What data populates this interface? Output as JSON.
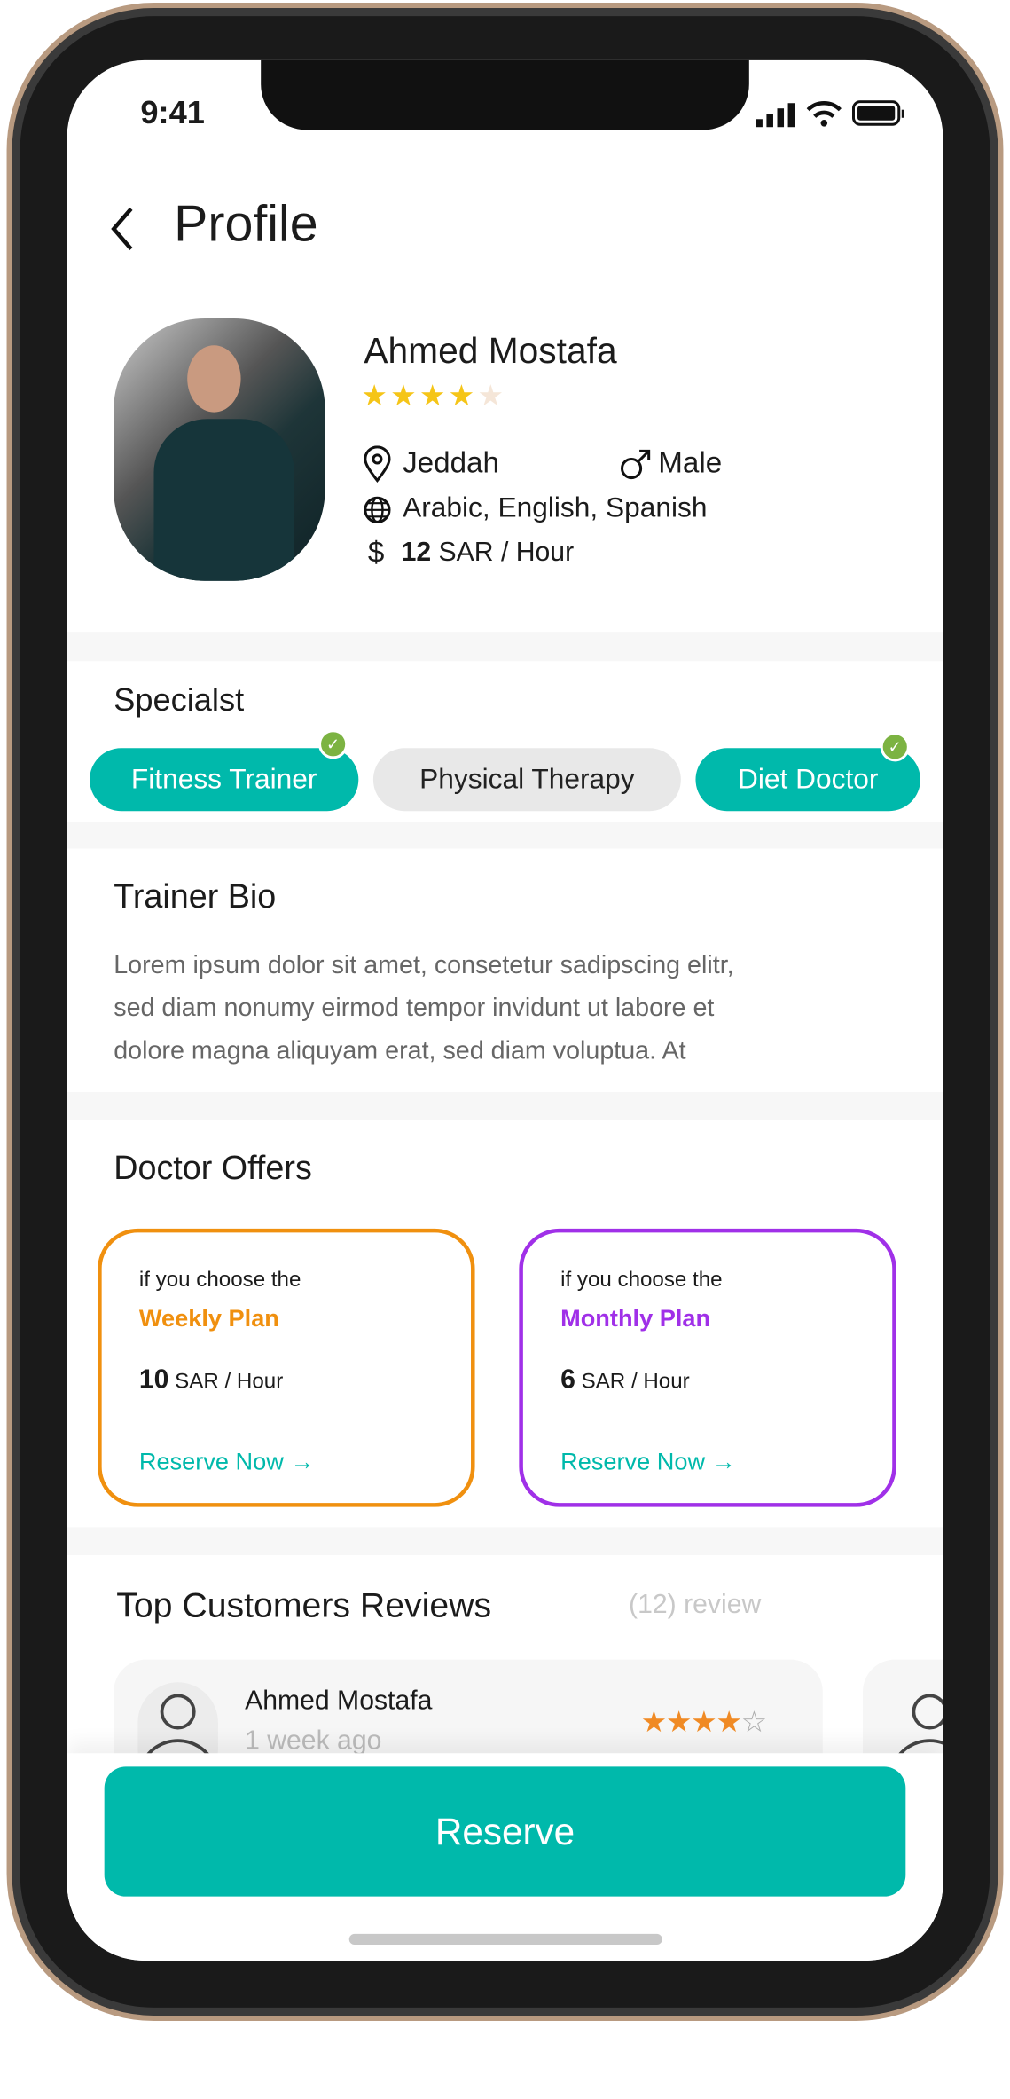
{
  "status": {
    "time": "9:41"
  },
  "header": {
    "title": "Profile"
  },
  "profile": {
    "name": "Ahmed Mostafa",
    "rating": 4,
    "max_rating": 5,
    "city": "Jeddah",
    "gender": "Male",
    "languages": "Arabic, English, Spanish",
    "price": "12",
    "price_unit": "SAR / Hour"
  },
  "specialist": {
    "title": "Specialst",
    "chips": [
      {
        "label": "Fitness Trainer",
        "selected": true
      },
      {
        "label": "Physical Therapy",
        "selected": false
      },
      {
        "label": "Diet Doctor",
        "selected": true
      }
    ]
  },
  "bio": {
    "title": "Trainer Bio",
    "lines": [
      "Lorem ipsum dolor sit amet, consetetur sadipscing elitr,",
      "sed diam nonumy eirmod tempor invidunt ut labore et",
      "dolore magna aliquyam erat, sed diam voluptua. At"
    ]
  },
  "offers": {
    "title": "Doctor Offers",
    "cards": [
      {
        "intro": "if you choose the",
        "plan": "Weekly Plan",
        "price": "10",
        "unit": "SAR / Hour",
        "cta": "Reserve Now",
        "color": "#f0900f"
      },
      {
        "intro": "if you choose the",
        "plan": "Monthly Plan",
        "price": "6",
        "unit": "SAR / Hour",
        "cta": "Reserve Now",
        "color": "#a030e8"
      }
    ]
  },
  "reviews": {
    "title": "Top Customers Reviews",
    "count": "(12) review",
    "items": [
      {
        "name": "Ahmed Mostafa",
        "time": "1 week ago",
        "rating": 4
      }
    ]
  },
  "footer": {
    "reserve": "Reserve"
  },
  "colors": {
    "accent": "#00b9ab",
    "star": "#f5c518",
    "review_star": "#f08a24"
  }
}
